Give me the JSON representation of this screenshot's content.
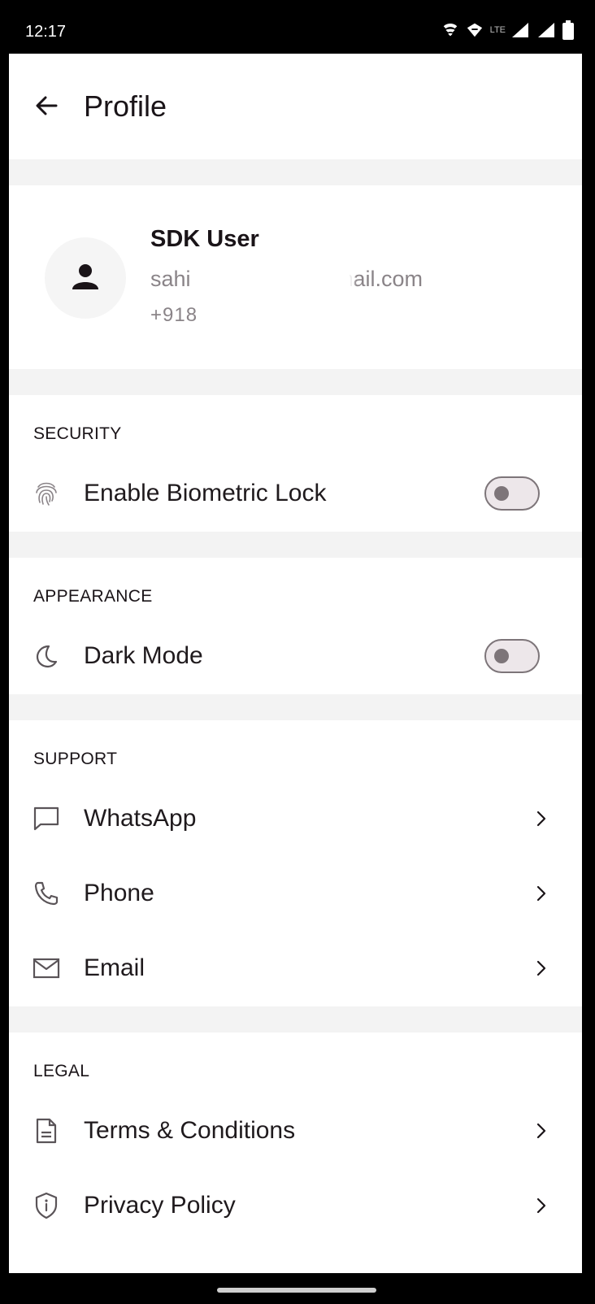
{
  "status_bar": {
    "time": "12:17",
    "network_label": "LTE",
    "icons": [
      "wifi-calling-icon",
      "vpn-icon",
      "signal-icon",
      "signal-icon",
      "battery-icon"
    ]
  },
  "header": {
    "title": "Profile",
    "back_icon": "arrow-left-icon"
  },
  "profile": {
    "name": "SDK User",
    "email_visible_start": "sahi",
    "email_visible_end": "@gmail.com",
    "phone_visible": "+918",
    "avatar_icon": "person-icon"
  },
  "sections": {
    "security": {
      "title": "SECURITY",
      "items": [
        {
          "label": "Enable Biometric Lock",
          "icon": "fingerprint-icon",
          "control": "toggle",
          "enabled": false
        }
      ]
    },
    "appearance": {
      "title": "APPEARANCE",
      "items": [
        {
          "label": "Dark Mode",
          "icon": "moon-icon",
          "control": "toggle",
          "enabled": false
        }
      ]
    },
    "support": {
      "title": "SUPPORT",
      "items": [
        {
          "label": "WhatsApp",
          "icon": "chat-bubble-icon",
          "control": "chevron"
        },
        {
          "label": "Phone",
          "icon": "phone-icon",
          "control": "chevron"
        },
        {
          "label": "Email",
          "icon": "mail-icon",
          "control": "chevron"
        }
      ]
    },
    "legal": {
      "title": "LEGAL",
      "items": [
        {
          "label": "Terms & Conditions",
          "icon": "document-icon",
          "control": "chevron"
        },
        {
          "label": "Privacy Policy",
          "icon": "shield-info-icon",
          "control": "chevron"
        }
      ]
    }
  },
  "colors": {
    "text_primary": "#1a1418",
    "text_secondary": "#8a8488",
    "divider": "#f3f3f3",
    "toggle_off": "#7d7579"
  }
}
